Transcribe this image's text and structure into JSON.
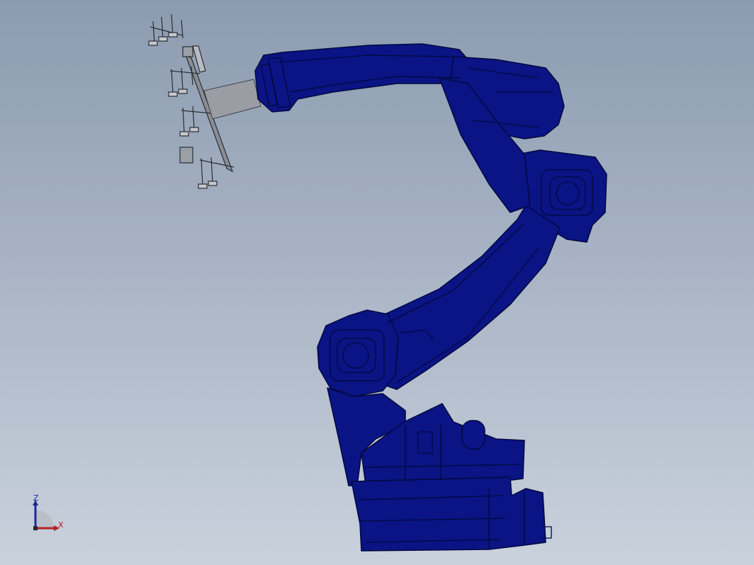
{
  "viewport": {
    "background_top": "#8c9bb0",
    "background_bottom": "#c9d1dc"
  },
  "model": {
    "robot_color": "#0a1484",
    "robot_edge_color": "#03083f",
    "tool_color": "#9a9ea4"
  },
  "triad": {
    "z_label": "Z",
    "x_label": "X",
    "z_color": "#1a2a9a",
    "x_color": "#b4202a"
  }
}
